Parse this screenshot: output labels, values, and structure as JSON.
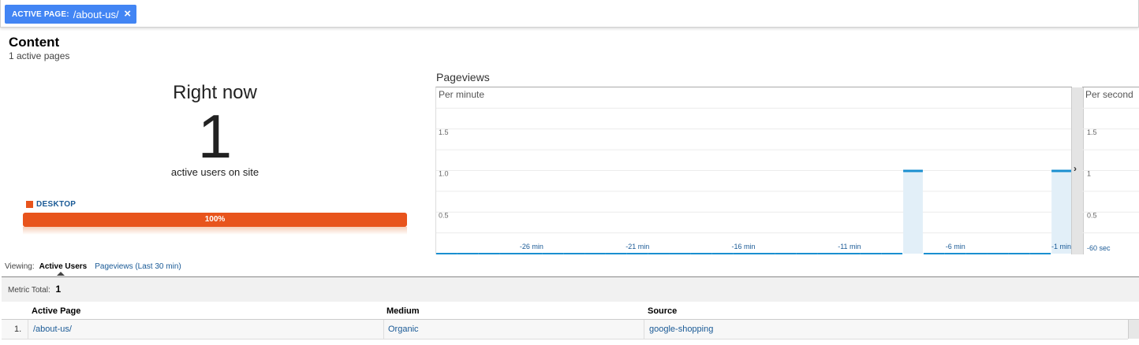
{
  "filter": {
    "label": "ACTIVE PAGE:",
    "value": "/about-us/",
    "close": "×"
  },
  "header": {
    "title": "Content",
    "subtitle": "1 active pages"
  },
  "rightnow": {
    "heading": "Right now",
    "count": "1",
    "caption": "active users on site",
    "device_label": "DESKTOP",
    "device_percent": "100%",
    "colors": {
      "device": "#e8541c",
      "accent": "#4285f4"
    }
  },
  "pageviews": {
    "title": "Pageviews",
    "per_minute_label": "Per minute",
    "per_second_label": "Per second",
    "arrow": "›"
  },
  "chart_data": [
    {
      "type": "bar",
      "title": "Per minute",
      "y_ticks": [
        "1.5",
        "1.0",
        "0.5"
      ],
      "ylim": [
        0,
        2
      ],
      "x_tick_labels": [
        "-26 min",
        "-21 min",
        "-16 min",
        "-11 min",
        "-6 min",
        "-1 min"
      ],
      "x": [
        -30,
        -29,
        -28,
        -27,
        -26,
        -25,
        -24,
        -23,
        -22,
        -21,
        -20,
        -19,
        -18,
        -17,
        -16,
        -15,
        -14,
        -13,
        -12,
        -11,
        -10,
        -9,
        -8,
        -7,
        -6,
        -5,
        -4,
        -3,
        -2,
        -1
      ],
      "values": [
        0,
        0,
        0,
        0,
        0,
        0,
        0,
        0,
        0,
        0,
        0,
        0,
        0,
        0,
        0,
        0,
        0,
        0,
        0,
        0,
        0,
        0,
        1,
        0,
        0,
        0,
        0,
        0,
        0,
        1
      ],
      "color": "#1a8fd0"
    },
    {
      "type": "bar",
      "title": "Per second",
      "y_ticks": [
        "1.5",
        "1",
        "0.5"
      ],
      "ylim": [
        0,
        2
      ],
      "x_tick_labels": [
        "-60 sec"
      ],
      "values": []
    }
  ],
  "table": {
    "viewing_label": "Viewing:",
    "viewing_active": "Active Users",
    "viewing_link": "Pageviews (Last 30 min)",
    "metric_total_label": "Metric Total:",
    "metric_total_value": "1",
    "columns": [
      "Active Page",
      "Medium",
      "Source"
    ],
    "rows": [
      {
        "index": "1.",
        "page": "/about-us/",
        "medium": "Organic",
        "source": "google-shopping"
      }
    ]
  }
}
